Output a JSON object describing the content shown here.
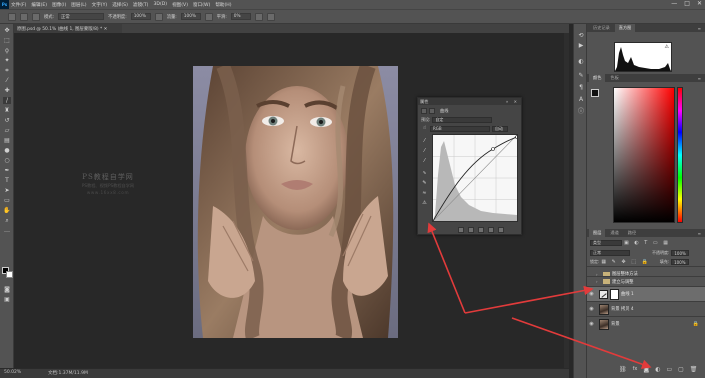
{
  "menu": {
    "app": "Ps",
    "items": [
      "文件(F)",
      "编辑(E)",
      "图像(I)",
      "图层(L)",
      "文字(Y)",
      "选择(S)",
      "滤镜(T)",
      "3D(D)",
      "视图(V)",
      "窗口(W)",
      "帮助(H)"
    ],
    "window_controls": [
      "—",
      "□",
      "✕"
    ]
  },
  "options": {
    "mode_label": "模式:",
    "mode_value": "正常",
    "opacity_label": "不透明度:",
    "opacity_value": "100%",
    "flow_label": "流量:",
    "flow_value": "100%",
    "smooth_label": "平滑:",
    "smooth_value": "0%"
  },
  "document": {
    "tab_title": "原图.psd @ 50.1% (曲线 1, 图层蒙版/8) * ✕",
    "zoom": "50.02%",
    "size": "文档:1.37M/11.9M"
  },
  "watermark": {
    "line1": "PS教程自学网",
    "line2": "PS教程、视频PS教程自学网",
    "line3": "www.16xx8.com"
  },
  "properties": {
    "tab": "属性",
    "panel_title": "曲线",
    "preset_label": "预设:",
    "preset_value": "自定",
    "channel_value": "RGB",
    "auto_button": "自动"
  },
  "right_panels": {
    "top_tabs": [
      "历史记录",
      "直方图"
    ],
    "color_tabs": [
      "颜色",
      "色板"
    ],
    "layer_tabs": [
      "图层",
      "通道",
      "路径"
    ]
  },
  "layers": {
    "kind_value": "类型",
    "blend_mode": "正常",
    "opacity_label": "不透明度:",
    "opacity_value": "100%",
    "lock_label": "锁定:",
    "fill_label": "填充:",
    "fill_value": "100%",
    "items": [
      {
        "name": "图层整体方法",
        "kind": "folder"
      },
      {
        "name": "建立与调整",
        "kind": "folder"
      },
      {
        "name": "曲线 1",
        "kind": "adjustment"
      },
      {
        "name": "背景 拷贝 4",
        "kind": "image"
      },
      {
        "name": "背景",
        "kind": "image"
      }
    ]
  },
  "icons": {
    "toolbar": [
      "move-icon",
      "marquee-icon",
      "lasso-icon",
      "magic-wand-icon",
      "crop-icon",
      "eyedropper-icon",
      "healing-icon",
      "brush-icon",
      "stamp-icon",
      "history-brush-icon",
      "eraser-icon",
      "gradient-icon",
      "blur-icon",
      "dodge-icon",
      "pen-icon",
      "type-icon",
      "path-select-icon",
      "shape-icon",
      "hand-icon",
      "zoom-icon"
    ]
  },
  "colors": {
    "annotation_arrow": "#e23b3b",
    "ui_background": "#535353",
    "canvas_background": "#282828"
  }
}
